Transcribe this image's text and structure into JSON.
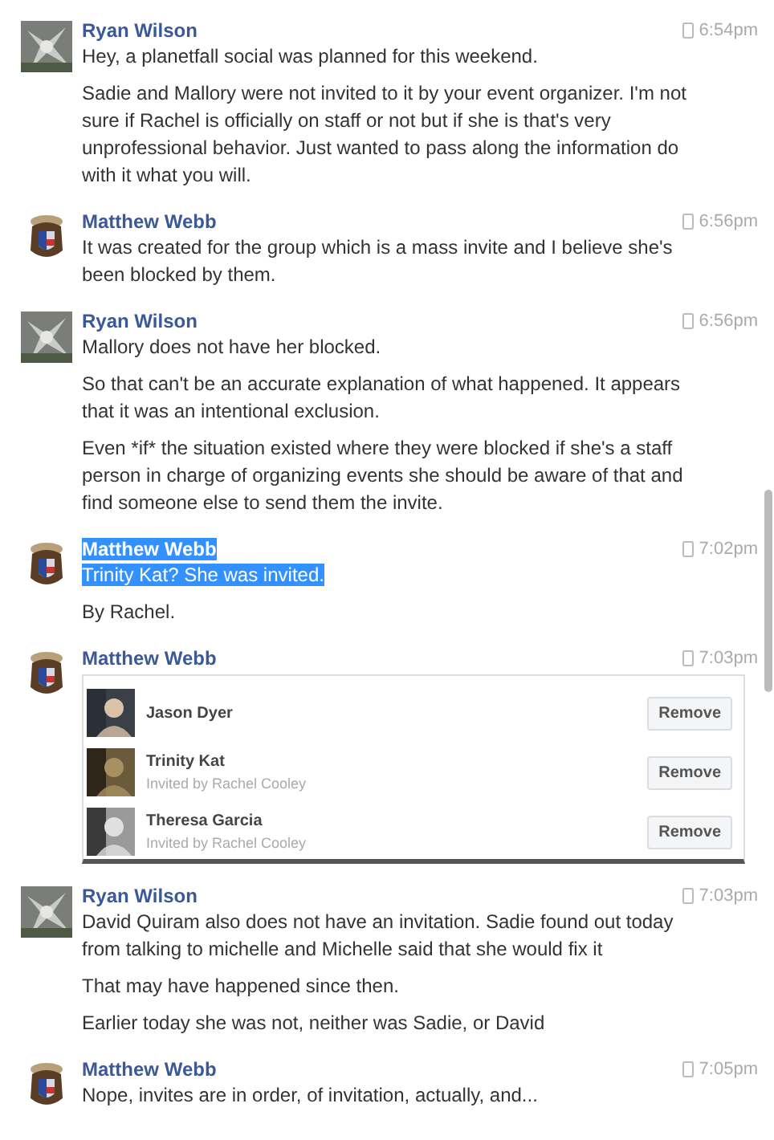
{
  "messages": [
    {
      "author": "Ryan Wilson",
      "avatar": {
        "kind": "grey"
      },
      "time": "6:54pm",
      "author_highlighted": false,
      "paragraphs": [
        {
          "text": "Hey, a planetfall social was planned for this weekend.",
          "highlighted": false
        },
        {
          "text": "Sadie and Mallory were not invited to it by your event organizer. I'm not sure if Rachel is officially on staff or not but if she is that's very unprofessional behavior. Just wanted to pass along the information do with it what you will.",
          "highlighted": false
        }
      ]
    },
    {
      "author": "Matthew Webb",
      "avatar": {
        "kind": "badge"
      },
      "time": "6:56pm",
      "author_highlighted": false,
      "paragraphs": [
        {
          "text": "It was created for the group which is a mass invite and I believe she's been blocked by them.",
          "highlighted": false
        }
      ]
    },
    {
      "author": "Ryan Wilson",
      "avatar": {
        "kind": "grey"
      },
      "time": "6:56pm",
      "author_highlighted": false,
      "paragraphs": [
        {
          "text": "Mallory does not have her blocked.",
          "highlighted": false
        },
        {
          "text": "So that can't be an accurate explanation of what happened. It appears that it was an intentional exclusion.",
          "highlighted": false
        },
        {
          "text": "Even *if* the situation existed where they were blocked if she's a staff person in charge of organizing events she should be aware of that and find someone else to send them the invite.",
          "highlighted": false
        }
      ]
    },
    {
      "author": "Matthew Webb",
      "avatar": {
        "kind": "badge"
      },
      "time": "7:02pm",
      "author_highlighted": true,
      "paragraphs": [
        {
          "text": "Trinity Kat? She was invited.",
          "highlighted": true
        },
        {
          "text": "By Rachel.",
          "highlighted": false
        }
      ]
    },
    {
      "author": "Matthew Webb",
      "avatar": {
        "kind": "badge"
      },
      "time": "7:03pm",
      "author_highlighted": false,
      "attachment": {
        "rows": [
          {
            "name": "Jason Dyer",
            "button": "Remove"
          },
          {
            "name": "Trinity Kat",
            "subtitle": "Invited by Rachel Cooley",
            "button": "Remove"
          },
          {
            "name": "Theresa Garcia",
            "subtitle": "Invited by Rachel Cooley",
            "button": "Remove"
          }
        ]
      }
    },
    {
      "author": "Ryan Wilson",
      "avatar": {
        "kind": "grey"
      },
      "time": "7:03pm",
      "author_highlighted": false,
      "paragraphs": [
        {
          "text": "David Quiram also does not have an invitation. Sadie found out today from talking to michelle and Michelle said that she would fix it",
          "highlighted": false
        },
        {
          "text": "That may have happened since then.",
          "highlighted": false
        },
        {
          "text": "Earlier today she was not, neither was Sadie, or David",
          "highlighted": false
        }
      ]
    },
    {
      "author": "Matthew Webb",
      "avatar": {
        "kind": "badge"
      },
      "time": "7:05pm",
      "author_highlighted": false,
      "paragraphs": [
        {
          "text": "Nope, invites are in order, of invitation, actually, and...",
          "highlighted": false
        }
      ]
    }
  ]
}
